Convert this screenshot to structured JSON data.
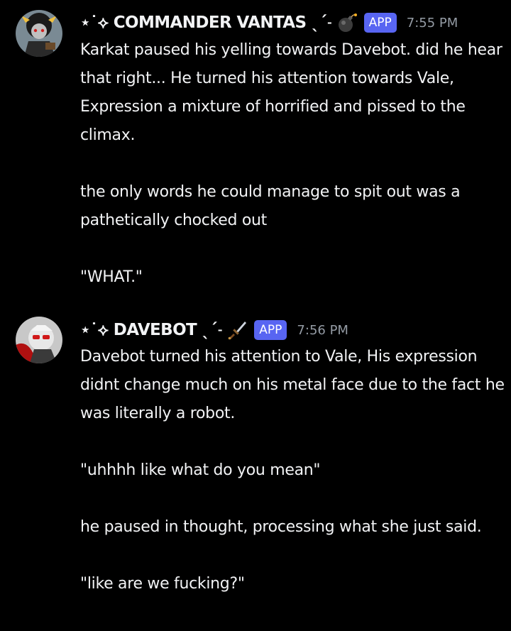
{
  "messages": [
    {
      "username": "⋆˙⟡ COMMANDER VANTAS ˎˊ˗",
      "emoji_icon": "bomb-icon",
      "badge": "APP",
      "timestamp": "7:55 PM",
      "paragraphs": [
        "Karkat paused his yelling towards Davebot. did he hear that right... He turned his attention towards Vale, Expression a mixture of horrified and pissed to the climax.",
        "the only words he could manage to spit out was a pathetically chocked out",
        "\"WHAT.\""
      ]
    },
    {
      "username": "⋆˙⟡ DAVEBOT ˎˊ˗",
      "emoji_icon": "dagger-icon",
      "badge": "APP",
      "timestamp": "7:56 PM",
      "paragraphs": [
        "Davebot turned his attention to Vale, His expression didnt change much on his metal face due to the fact he was literally a robot.",
        "\"uhhhh like what do you mean\"",
        "he paused in thought, processing what she just said.",
        "\"like are we fucking?\""
      ]
    }
  ],
  "colors": {
    "background": "#000000",
    "text": "#f2f3f5",
    "timestamp": "#949ba4",
    "app_badge": "#5865f2"
  }
}
